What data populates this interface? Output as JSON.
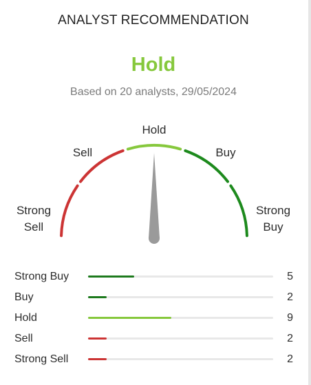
{
  "widget": {
    "title": "ANALYST RECOMMENDATION",
    "consensus": "Hold",
    "based_on": "Based on 20 analysts, 29/05/2024",
    "total_analysts": 20,
    "consensus_color": "#86c83c"
  },
  "gauge": {
    "labels": {
      "strong_sell_line1": "Strong",
      "strong_sell_line2": "Sell",
      "sell": "Sell",
      "hold": "Hold",
      "buy": "Buy",
      "strong_buy_line1": "Strong",
      "strong_buy_line2": "Buy"
    },
    "segment_colors": [
      "#cc3434",
      "#cc3434",
      "#86c83c",
      "#1d8a1d",
      "#1d8a1d"
    ],
    "needle_color": "#9a9a9a",
    "needle_position": 0.5
  },
  "breakdown": [
    {
      "label": "Strong Buy",
      "count": 5,
      "color": "#1d7a1d"
    },
    {
      "label": "Buy",
      "count": 2,
      "color": "#1d7a1d"
    },
    {
      "label": "Hold",
      "count": 9,
      "color": "#86c83c"
    },
    {
      "label": "Sell",
      "count": 2,
      "color": "#cc3434"
    },
    {
      "label": "Strong Sell",
      "count": 2,
      "color": "#cc3434"
    }
  ]
}
